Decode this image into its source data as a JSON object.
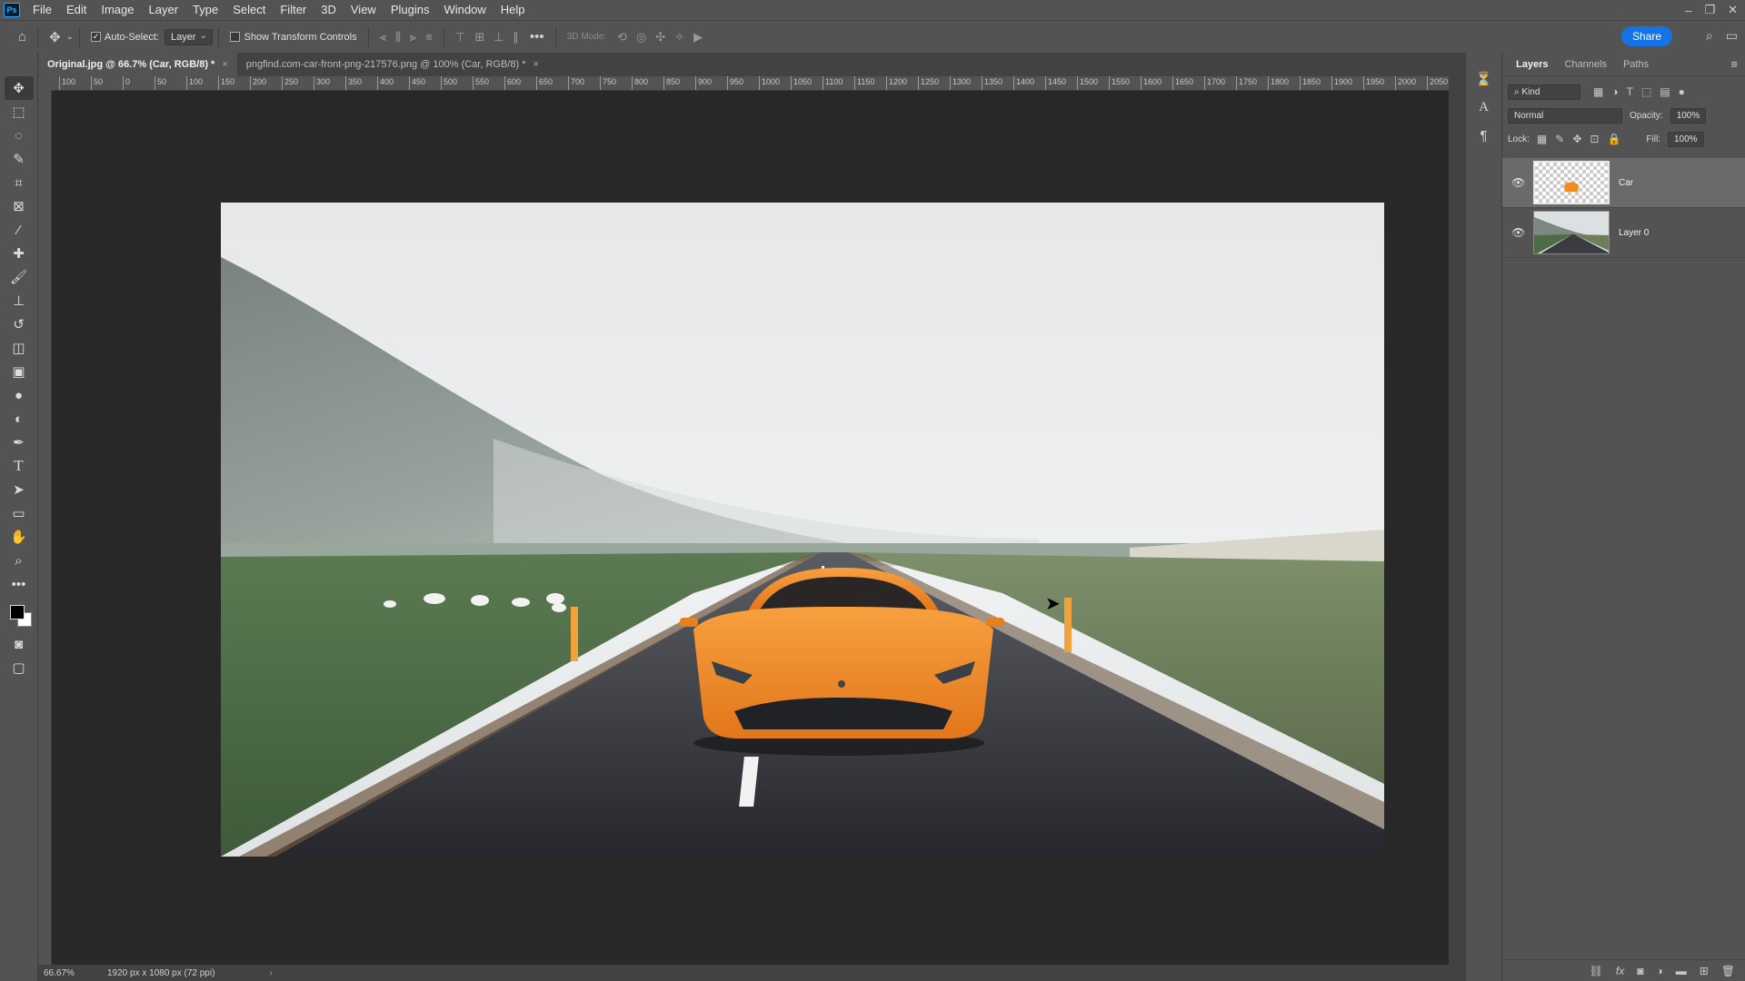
{
  "app": {
    "logo": "Ps"
  },
  "menu": [
    "File",
    "Edit",
    "Image",
    "Layer",
    "Type",
    "Select",
    "Filter",
    "3D",
    "View",
    "Plugins",
    "Window",
    "Help"
  ],
  "window_controls": [
    "–",
    "❐",
    "✕"
  ],
  "options": {
    "auto_select_label": "Auto-Select:",
    "auto_select_checked": "✓",
    "auto_select_target": "Layer",
    "show_transform_label": "Show Transform Controls",
    "mode_label": "3D Mode:",
    "more": "•••",
    "share_label": "Share"
  },
  "tabs": [
    {
      "label": "Original.jpg @ 66.7% (Car, RGB/8) *",
      "close": "×"
    },
    {
      "label": "pngfind.com-car-front-png-217576.png @ 100% (Car, RGB/8) *",
      "close": "×"
    }
  ],
  "ruler_ticks": [
    "100",
    "50",
    "0",
    "50",
    "100",
    "150",
    "200",
    "250",
    "300",
    "350",
    "400",
    "450",
    "500",
    "550",
    "600",
    "650",
    "700",
    "750",
    "800",
    "850",
    "900",
    "950",
    "1000",
    "1050",
    "1100",
    "1150",
    "1200",
    "1250",
    "1300",
    "1350",
    "1400",
    "1450",
    "1500",
    "1550",
    "1600",
    "1650",
    "1700",
    "1750",
    "1800",
    "1850",
    "1900",
    "1950",
    "2000",
    "2050"
  ],
  "status": {
    "zoom": "66.67%",
    "doc_info": "1920 px x 1080 px (72 ppi)",
    "arrow": "›"
  },
  "layers_panel": {
    "tabs": [
      "Layers",
      "Channels",
      "Paths"
    ],
    "filter_kind": "Kind",
    "blend_mode": "Normal",
    "opacity_label": "Opacity:",
    "opacity_value": "100%",
    "lock_label": "Lock:",
    "fill_label": "Fill:",
    "fill_value": "100%",
    "layers": [
      {
        "name": "Car",
        "selected": true
      },
      {
        "name": "Layer 0",
        "selected": false
      }
    ]
  },
  "colors": {
    "car": "#f28a1e",
    "accent": "#1473e6"
  }
}
